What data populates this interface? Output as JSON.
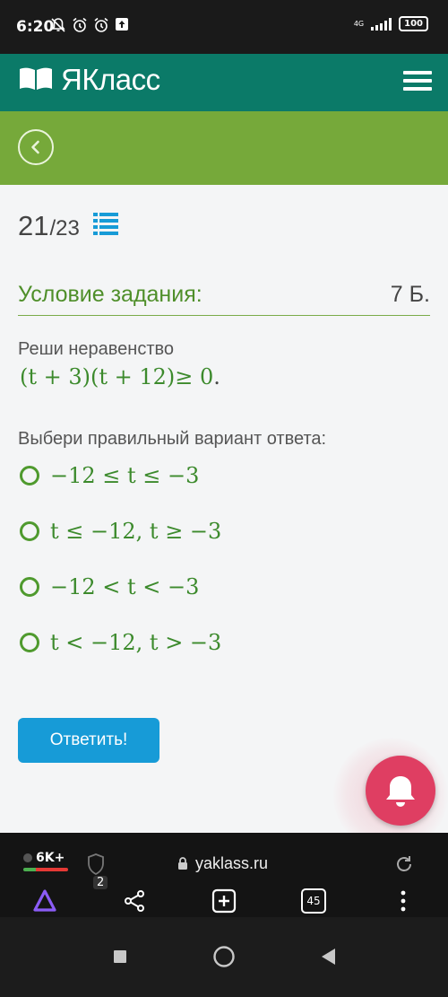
{
  "status_bar": {
    "time": "6:20",
    "network": "4G",
    "battery": "100",
    "left_icons": [
      "mute-bell-icon",
      "alarm-icon",
      "alarm-icon",
      "upload-icon"
    ]
  },
  "header": {
    "logo_text": "ЯКласс",
    "logo_icon": "book-icon",
    "menu_icon": "hamburger-menu-icon"
  },
  "nav": {
    "back_icon": "chevron-left-icon"
  },
  "progress": {
    "current": "21",
    "total": "/23",
    "list_icon": "list-icon"
  },
  "task": {
    "condition_title": "Условие задания:",
    "points": "7 Б.",
    "prompt": "Реши неравенство",
    "inequality": "(t + 3)(t + 12)≥ 0",
    "inequality_end": ".",
    "choose_prompt": "Выбери правильный вариант ответа:",
    "options": [
      "−12 ≤ t ≤ −3",
      "t ≤ −12, t ≥ −3",
      "−12 < t < −3",
      "t < −12,  t > −3"
    ],
    "submit_label": "Ответить!"
  },
  "browser": {
    "tabs_label": "6K+",
    "shield_count": "2",
    "url": "yaklass.ru",
    "tab_count": "45"
  },
  "colors": {
    "header": "#0b7a68",
    "back_bar": "#76a93a",
    "accent_green": "#4f8f2a",
    "button_blue": "#179bd7",
    "bell_red": "#df3e62"
  }
}
